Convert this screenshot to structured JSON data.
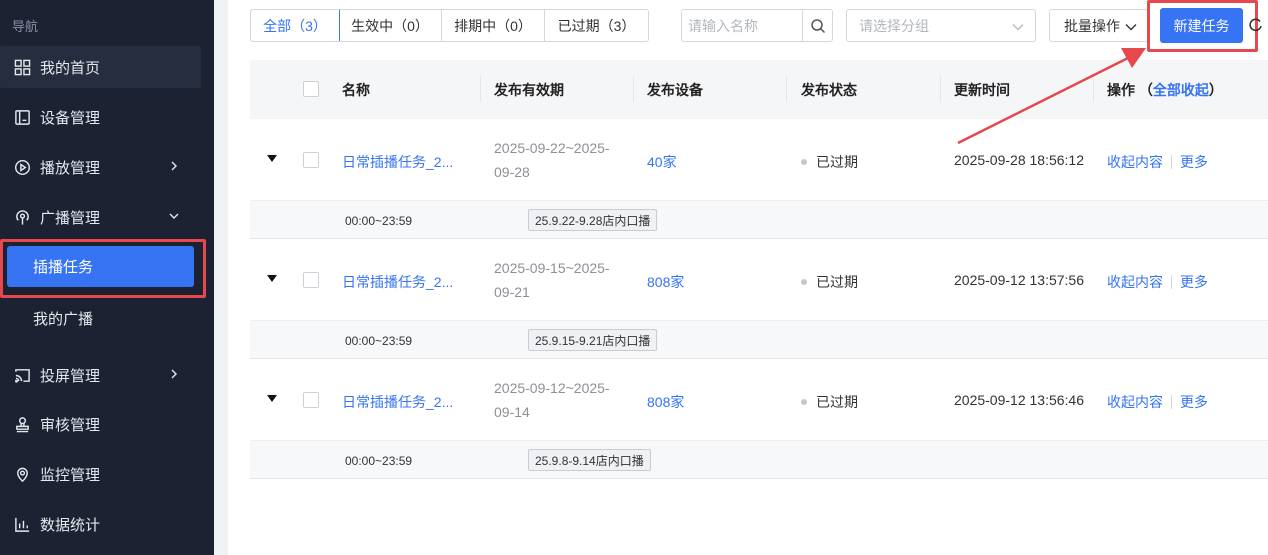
{
  "sidebar": {
    "header": "导航",
    "items": [
      {
        "label": "我的首页",
        "icon": "grid-icon"
      },
      {
        "label": "设备管理",
        "icon": "device-icon"
      },
      {
        "label": "播放管理",
        "icon": "play-icon"
      },
      {
        "label": "广播管理",
        "icon": "broadcast-icon"
      },
      {
        "label": "投屏管理",
        "icon": "cast-icon"
      },
      {
        "label": "审核管理",
        "icon": "stamp-icon"
      },
      {
        "label": "监控管理",
        "icon": "monitor-icon"
      },
      {
        "label": "数据统计",
        "icon": "chart-icon"
      }
    ],
    "subitems": [
      {
        "label": "插播任务",
        "active": true
      },
      {
        "label": "我的广播",
        "active": false
      }
    ]
  },
  "toolbar": {
    "tabs": [
      {
        "label": "全部（3）",
        "active": true
      },
      {
        "label": "生效中（0）",
        "active": false
      },
      {
        "label": "排期中（0）",
        "active": false
      },
      {
        "label": "已过期（3）",
        "active": false
      }
    ],
    "search_placeholder": "请输入名称",
    "group_placeholder": "请选择分组",
    "batch_label": "批量操作",
    "new_task_label": "新建任务"
  },
  "table": {
    "columns": {
      "name": "名称",
      "period": "发布有效期",
      "devices": "发布设备",
      "status": "发布状态",
      "updated": "更新时间",
      "ops": "操作",
      "collapse_all_prefix": "（",
      "collapse_all": "全部收起",
      "collapse_all_suffix": "）"
    },
    "rows": [
      {
        "name": "日常插播任务_2...",
        "period_line1": "2025-09-22~2025-",
        "period_line2": "09-28",
        "devices": "40家",
        "status": "已过期",
        "updated": "2025-09-28 18:56:12",
        "op_collapse": "收起内容",
        "op_more": "更多",
        "sub_time": "00:00~23:59",
        "sub_tag": "25.9.22-9.28店内口播"
      },
      {
        "name": "日常插播任务_2...",
        "period_line1": "2025-09-15~2025-",
        "period_line2": "09-21",
        "devices": "808家",
        "status": "已过期",
        "updated": "2025-09-12 13:57:56",
        "op_collapse": "收起内容",
        "op_more": "更多",
        "sub_time": "00:00~23:59",
        "sub_tag": "25.9.15-9.21店内口播"
      },
      {
        "name": "日常插播任务_2...",
        "period_line1": "2025-09-12~2025-",
        "period_line2": "09-14",
        "devices": "808家",
        "status": "已过期",
        "updated": "2025-09-12 13:56:46",
        "op_collapse": "收起内容",
        "op_more": "更多",
        "sub_time": "00:00~23:59",
        "sub_tag": "25.9.8-9.14店内口播"
      }
    ]
  },
  "colors": {
    "sidebar_bg": "#1c2232",
    "accent": "#3674f4",
    "annotation_red": "#e5484d"
  }
}
